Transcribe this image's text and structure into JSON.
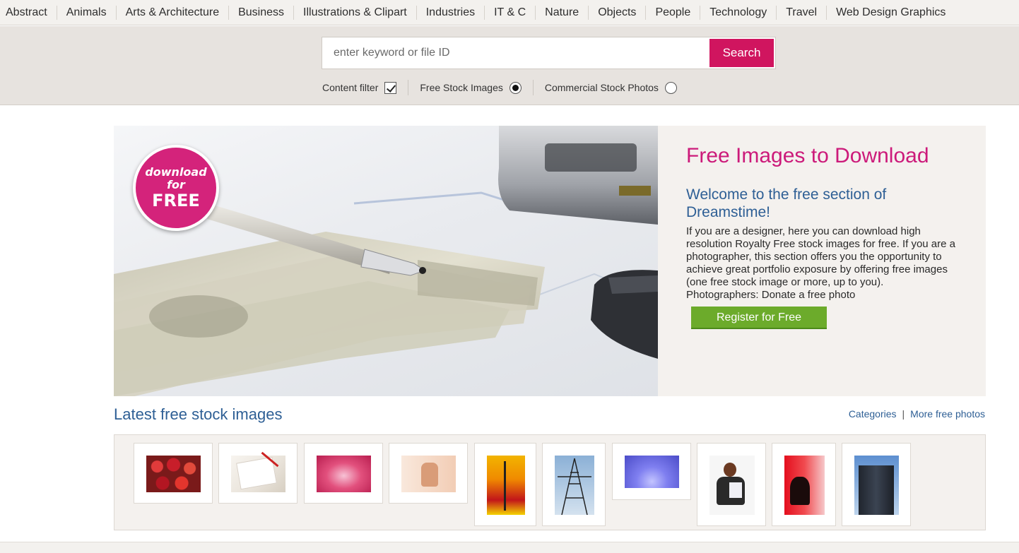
{
  "nav": {
    "categories": [
      "Abstract",
      "Animals",
      "Arts & Architecture",
      "Business",
      "Illustrations & Clipart",
      "Industries",
      "IT & C",
      "Nature",
      "Objects",
      "People",
      "Technology",
      "Travel",
      "Web Design Graphics"
    ]
  },
  "search": {
    "placeholder": "enter keyword or file ID",
    "value": "",
    "button_label": "Search"
  },
  "filters": {
    "content_filter_label": "Content filter",
    "content_filter_checked": true,
    "free_label": "Free Stock Images",
    "free_selected": true,
    "commercial_label": "Commercial Stock Photos",
    "commercial_selected": false
  },
  "hero": {
    "badge_line1": "download",
    "badge_line2": "for",
    "badge_line3": "FREE",
    "title": "Free Images to Download",
    "subtitle": "Welcome to the free section of Dreamstime!",
    "body": "If you are a designer, here you can download high resolution Royalty Free stock images for free. If you are a photographer, this section offers you the opportunity to achieve great portfolio exposure by offering free images (one free stock image or more, up to you).",
    "donate": "Photographers: Donate a free photo",
    "register_label": "Register for Free"
  },
  "latest": {
    "title": "Latest free stock images",
    "categories_link": "Categories",
    "separator": "|",
    "more_link": "More free photos"
  },
  "colors": {
    "accent": "#d0155f",
    "title_pink": "#cc1a7a",
    "link_blue": "#2e5f95",
    "register_green": "#6cab2b"
  }
}
